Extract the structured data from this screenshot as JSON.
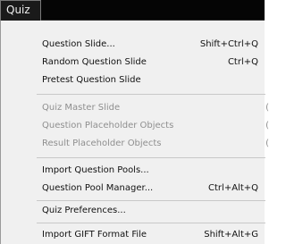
{
  "menubar": {
    "quiz_label": "Quiz"
  },
  "menu": {
    "items": [
      {
        "label": "Question Slide...",
        "shortcut": "Shift+Ctrl+Q",
        "disabled": false
      },
      {
        "label": "Random Question Slide",
        "shortcut": "Ctrl+Q",
        "disabled": false
      },
      {
        "label": "Pretest Question Slide",
        "shortcut": "",
        "disabled": false
      },
      {
        "label": "Quiz Master Slide",
        "shortcut": "(",
        "disabled": true
      },
      {
        "label": "Question Placeholder Objects",
        "shortcut": "(",
        "disabled": true
      },
      {
        "label": "Result Placeholder Objects",
        "shortcut": "(",
        "disabled": true
      },
      {
        "label": "Import Question Pools...",
        "shortcut": "",
        "disabled": false
      },
      {
        "label": "Question Pool Manager...",
        "shortcut": "Ctrl+Alt+Q",
        "disabled": false
      },
      {
        "label": "Quiz Preferences...",
        "shortcut": "",
        "disabled": false
      },
      {
        "label": "Import GIFT Format File",
        "shortcut": "Shift+Alt+G",
        "disabled": false
      }
    ]
  }
}
